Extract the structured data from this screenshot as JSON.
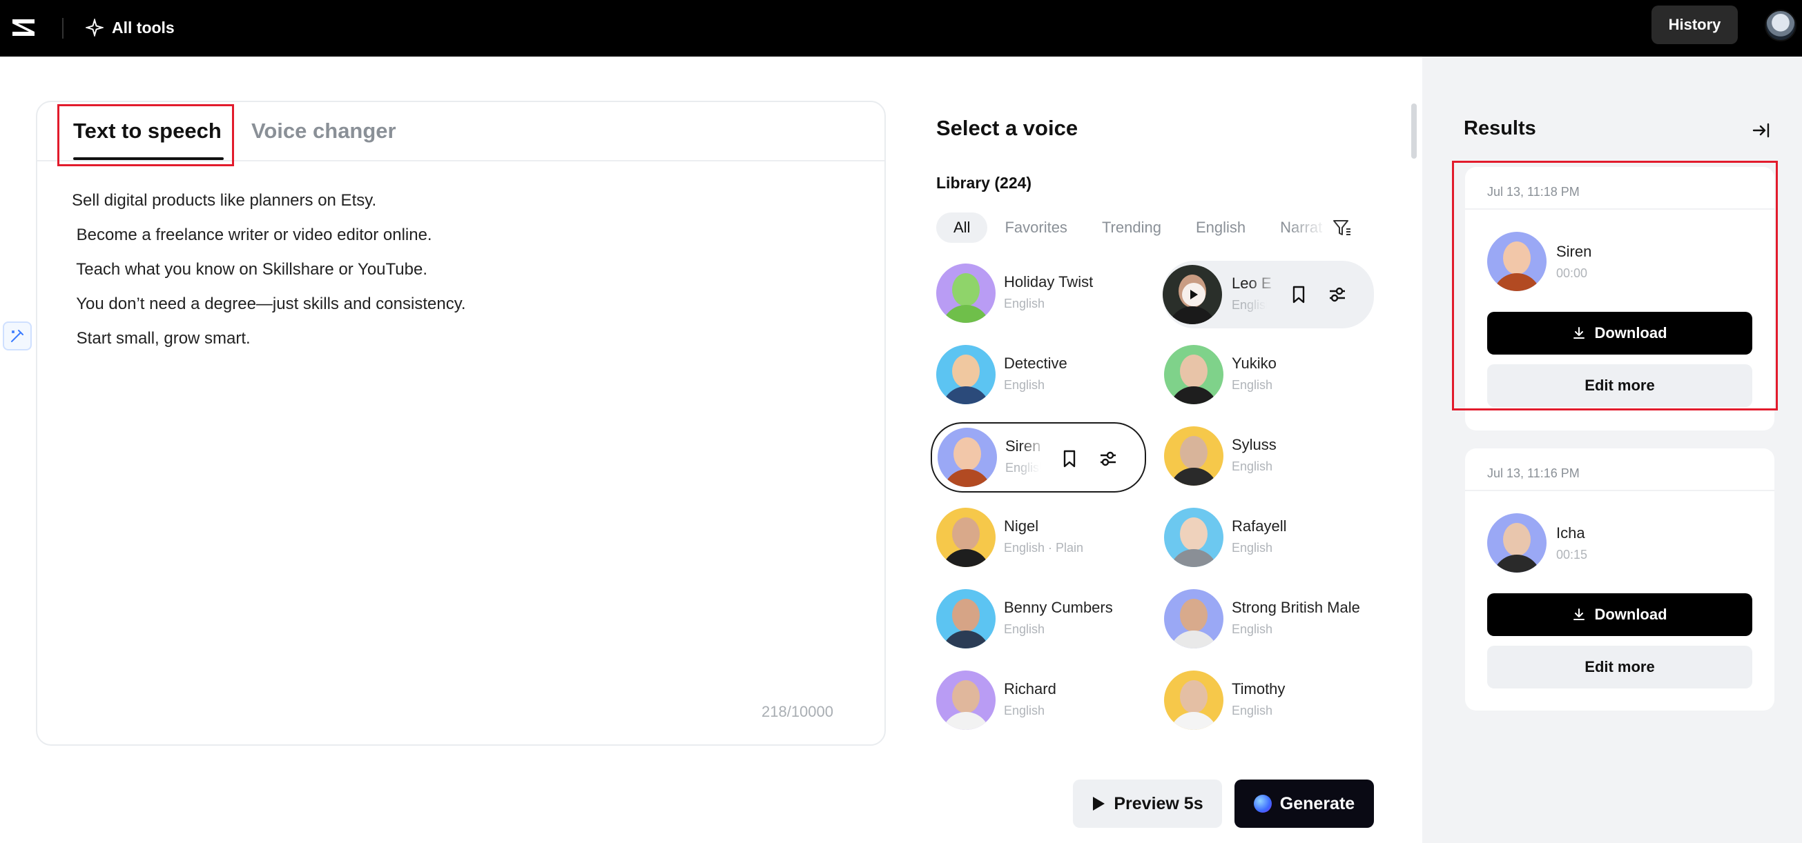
{
  "topbar": {
    "all_tools_label": "All tools",
    "history_label": "History"
  },
  "editor": {
    "tabs": [
      {
        "label": "Text to speech",
        "active": true
      },
      {
        "label": "Voice changer",
        "active": false
      }
    ],
    "text_lines": [
      "Sell digital products like planners on Etsy.",
      " Become a freelance writer or video editor online.",
      " Teach what you know on Skillshare or YouTube.",
      " You don’t need a degree—just skills and consistency.",
      " Start small, grow smart."
    ],
    "char_count": "218/10000"
  },
  "voice_panel": {
    "title": "Select a voice",
    "library_label": "Library (224)",
    "filters": [
      "All",
      "Favorites",
      "Trending",
      "English",
      "Narrat"
    ],
    "active_filter": "All",
    "voices": [
      {
        "name": "Holiday Twist",
        "lang": "English"
      },
      {
        "name": "Leo E",
        "lang": "English"
      },
      {
        "name": "Detective",
        "lang": "English"
      },
      {
        "name": "Yukiko",
        "lang": "English"
      },
      {
        "name": "Siren",
        "lang": "English"
      },
      {
        "name": "Syluss",
        "lang": "English"
      },
      {
        "name": "Nigel",
        "lang": "English · Plain"
      },
      {
        "name": "Rafayell",
        "lang": "English"
      },
      {
        "name": "Benny Cumbers",
        "lang": "English"
      },
      {
        "name": "Strong British Male",
        "lang": "English"
      },
      {
        "name": "Richard",
        "lang": "English"
      },
      {
        "name": "Timothy",
        "lang": "English"
      }
    ],
    "preview_label": "Preview 5s",
    "generate_label": "Generate"
  },
  "results": {
    "title": "Results",
    "items": [
      {
        "date": "Jul 13, 11:18 PM",
        "name": "Siren",
        "duration": "00:00",
        "download_label": "Download",
        "edit_label": "Edit more"
      },
      {
        "date": "Jul 13, 11:16 PM",
        "name": "Icha",
        "duration": "00:15",
        "download_label": "Download",
        "edit_label": "Edit more"
      }
    ]
  },
  "colors": {
    "accent_black": "#000000",
    "annotation_red": "#e21b2c",
    "panel_gray": "#f2f3f5"
  }
}
